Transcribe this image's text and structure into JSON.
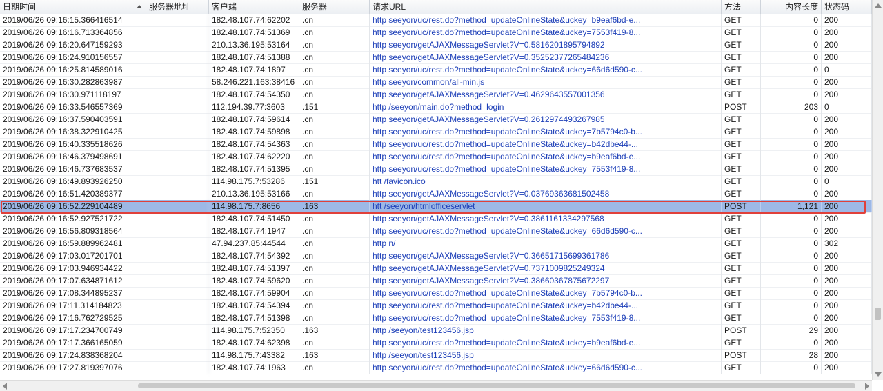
{
  "columns": {
    "time": "日期时间",
    "server_addr": "服务器地址",
    "client": "客户端",
    "server": "服务器",
    "url": "请求URL",
    "method": "方法",
    "length": "内容长度",
    "status": "状态码"
  },
  "rows": [
    {
      "time": "2019/06/26 09:16:15.366416514",
      "server_addr": "",
      "client": "182.48.107.74:62202",
      "server": ".cn",
      "url": "http            seeyon/uc/rest.do?method=updateOnlineState&uckey=b9eaf6bd-e...",
      "method": "GET",
      "length": "0",
      "status": "200"
    },
    {
      "time": "2019/06/26 09:16:16.713364856",
      "server_addr": "",
      "client": "182.48.107.74:51369",
      "server": ".cn",
      "url": "http            seeyon/uc/rest.do?method=updateOnlineState&uckey=7553f419-8...",
      "method": "GET",
      "length": "0",
      "status": "200"
    },
    {
      "time": "2019/06/26 09:16:20.647159293",
      "server_addr": "",
      "client": "210.13.36.195:53164",
      "server": ".cn",
      "url": "http            seeyon/getAJAXMessageServlet?V=0.5816201895794892",
      "method": "GET",
      "length": "0",
      "status": "200"
    },
    {
      "time": "2019/06/26 09:16:24.910156557",
      "server_addr": "",
      "client": "182.48.107.74:51388",
      "server": ".cn",
      "url": "http            seeyon/getAJAXMessageServlet?V=0.35252377265484236",
      "method": "GET",
      "length": "0",
      "status": "200"
    },
    {
      "time": "2019/06/26 09:16:25.814589016",
      "server_addr": "",
      "client": "182.48.107.74:1897",
      "server": ".cn",
      "url": "http            seeyon/uc/rest.do?method=updateOnlineState&uckey=66d6d590-c...",
      "method": "GET",
      "length": "0",
      "status": "0"
    },
    {
      "time": "2019/06/26 09:16:30.282863987",
      "server_addr": "",
      "client": "58.246.221.163:38416",
      "server": ".cn",
      "url": "http            seeyon/common/all-min.js",
      "method": "GET",
      "length": "0",
      "status": "200"
    },
    {
      "time": "2019/06/26 09:16:30.971118197",
      "server_addr": "",
      "client": "182.48.107.74:54350",
      "server": ".cn",
      "url": "http            seeyon/getAJAXMessageServlet?V=0.4629643557001356",
      "method": "GET",
      "length": "0",
      "status": "200"
    },
    {
      "time": "2019/06/26 09:16:33.546557369",
      "server_addr": "",
      "client": "112.194.39.77:3603",
      "server": ".151",
      "url": "http            /seeyon/main.do?method=login",
      "method": "POST",
      "length": "203",
      "status": "0"
    },
    {
      "time": "2019/06/26 09:16:37.590403591",
      "server_addr": "",
      "client": "182.48.107.74:59614",
      "server": ".cn",
      "url": "http            seeyon/getAJAXMessageServlet?V=0.2612974493267985",
      "method": "GET",
      "length": "0",
      "status": "200"
    },
    {
      "time": "2019/06/26 09:16:38.322910425",
      "server_addr": "",
      "client": "182.48.107.74:59898",
      "server": ".cn",
      "url": "http            seeyon/uc/rest.do?method=updateOnlineState&uckey=7b5794c0-b...",
      "method": "GET",
      "length": "0",
      "status": "200"
    },
    {
      "time": "2019/06/26 09:16:40.335518626",
      "server_addr": "",
      "client": "182.48.107.74:54363",
      "server": ".cn",
      "url": "http            seeyon/uc/rest.do?method=updateOnlineState&uckey=b42dbe44-...",
      "method": "GET",
      "length": "0",
      "status": "200"
    },
    {
      "time": "2019/06/26 09:16:46.379498691",
      "server_addr": "",
      "client": "182.48.107.74:62220",
      "server": ".cn",
      "url": "http            seeyon/uc/rest.do?method=updateOnlineState&uckey=b9eaf6bd-e...",
      "method": "GET",
      "length": "0",
      "status": "200"
    },
    {
      "time": "2019/06/26 09:16:46.737683537",
      "server_addr": "",
      "client": "182.48.107.74:51395",
      "server": ".cn",
      "url": "http            seeyon/uc/rest.do?method=updateOnlineState&uckey=7553f419-8...",
      "method": "GET",
      "length": "0",
      "status": "200"
    },
    {
      "time": "2019/06/26 09:16:49.893926250",
      "server_addr": "",
      "client": "114.98.175.7:53286",
      "server": ".151",
      "url": "htt             /favicon.ico",
      "method": "GET",
      "length": "0",
      "status": "0"
    },
    {
      "time": "2019/06/26 09:16:51.420389377",
      "server_addr": "",
      "client": "210.13.36.195:53166",
      "server": ".cn",
      "url": "http            seeyon/getAJAXMessageServlet?V=0.03769363681502458",
      "method": "GET",
      "length": "0",
      "status": "200"
    },
    {
      "time": "2019/06/26 09:16:52.229104489",
      "server_addr": "",
      "client": "114.98.175.7:8656",
      "server": ".163",
      "url": "htt             /seeyon/htmlofficeservlet",
      "method": "POST",
      "length": "1,121",
      "status": "200",
      "selected": true
    },
    {
      "time": "2019/06/26 09:16:52.927521722",
      "server_addr": "",
      "client": "182.48.107.74:51450",
      "server": ".cn",
      "url": "http            seeyon/getAJAXMessageServlet?V=0.3861161334297568",
      "method": "GET",
      "length": "0",
      "status": "200"
    },
    {
      "time": "2019/06/26 09:16:56.809318564",
      "server_addr": "",
      "client": "182.48.107.74:1947",
      "server": ".cn",
      "url": "http            seeyon/uc/rest.do?method=updateOnlineState&uckey=66d6d590-c...",
      "method": "GET",
      "length": "0",
      "status": "200"
    },
    {
      "time": "2019/06/26 09:16:59.889962481",
      "server_addr": "",
      "client": "47.94.237.85:44544",
      "server": ".cn",
      "url": "http            n/",
      "method": "GET",
      "length": "0",
      "status": "302"
    },
    {
      "time": "2019/06/26 09:17:03.017201701",
      "server_addr": "",
      "client": "182.48.107.74:54392",
      "server": ".cn",
      "url": "http            seeyon/getAJAXMessageServlet?V=0.36651715699361786",
      "method": "GET",
      "length": "0",
      "status": "200"
    },
    {
      "time": "2019/06/26 09:17:03.946934422",
      "server_addr": "",
      "client": "182.48.107.74:51397",
      "server": ".cn",
      "url": "http            seeyon/getAJAXMessageServlet?V=0.7371009825249324",
      "method": "GET",
      "length": "0",
      "status": "200"
    },
    {
      "time": "2019/06/26 09:17:07.634871612",
      "server_addr": "",
      "client": "182.48.107.74:59620",
      "server": ".cn",
      "url": "http            seeyon/getAJAXMessageServlet?V=0.38660367875672297",
      "method": "GET",
      "length": "0",
      "status": "200"
    },
    {
      "time": "2019/06/26 09:17:08.344895237",
      "server_addr": "",
      "client": "182.48.107.74:59904",
      "server": ".cn",
      "url": "http            seeyon/uc/rest.do?method=updateOnlineState&uckey=7b5794c0-b...",
      "method": "GET",
      "length": "0",
      "status": "200"
    },
    {
      "time": "2019/06/26 09:17:11.314184823",
      "server_addr": "",
      "client": "182.48.107.74:54394",
      "server": ".cn",
      "url": "http            seeyon/uc/rest.do?method=updateOnlineState&uckey=b42dbe44-...",
      "method": "GET",
      "length": "0",
      "status": "200"
    },
    {
      "time": "2019/06/26 09:17:16.762729525",
      "server_addr": "",
      "client": "182.48.107.74:51398",
      "server": ".cn",
      "url": "http            seeyon/uc/rest.do?method=updateOnlineState&uckey=7553f419-8...",
      "method": "GET",
      "length": "0",
      "status": "200"
    },
    {
      "time": "2019/06/26 09:17:17.234700749",
      "server_addr": "",
      "client": "114.98.175.7:52350",
      "server": ".163",
      "url": "http            /seeyon/test123456.jsp",
      "method": "POST",
      "length": "29",
      "status": "200"
    },
    {
      "time": "2019/06/26 09:17:17.366165059",
      "server_addr": "",
      "client": "182.48.107.74:62398",
      "server": ".cn",
      "url": "http            seeyon/uc/rest.do?method=updateOnlineState&uckey=b9eaf6bd-e...",
      "method": "GET",
      "length": "0",
      "status": "200"
    },
    {
      "time": "2019/06/26 09:17:24.838368204",
      "server_addr": "",
      "client": "114.98.175.7:43382",
      "server": ".163",
      "url": "http            /seeyon/test123456.jsp",
      "method": "POST",
      "length": "28",
      "status": "200"
    },
    {
      "time": "2019/06/26 09:17:27.819397076",
      "server_addr": "",
      "client": "182.48.107.74:1963",
      "server": ".cn",
      "url": "http            seeyon/uc/rest.do?method=updateOnlineState&uckey=66d6d590-c...",
      "method": "GET",
      "length": "0",
      "status": "200"
    }
  ],
  "colors": {
    "selection": "#9db8e6",
    "highlight_box": "#e0403a",
    "url_text": "#1d3fb8"
  }
}
